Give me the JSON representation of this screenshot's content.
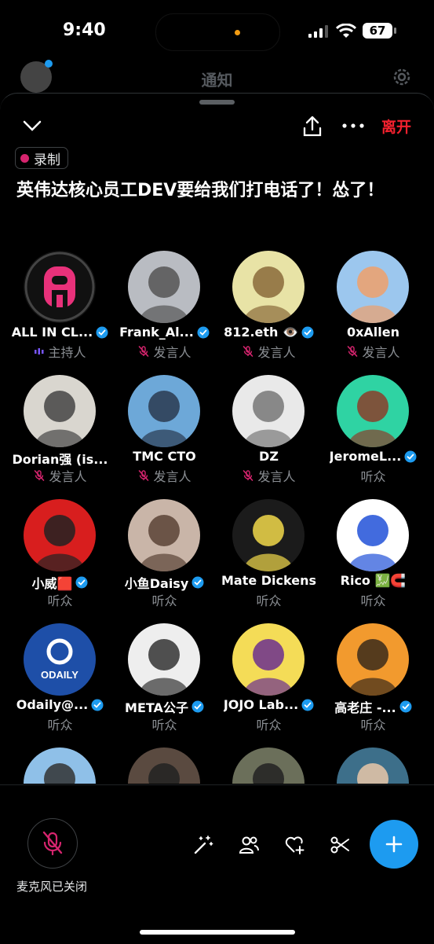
{
  "status_bar": {
    "time": "9:40",
    "battery": "67"
  },
  "background_header": {
    "title": "通知"
  },
  "space": {
    "leave_label": "离开",
    "recording_label": "录制",
    "title": "英伟达核心员工DEV要给我们打电话了！怂了！"
  },
  "participants": [
    {
      "name": "ALL IN CL...",
      "role": "主持人",
      "verified": true,
      "role_icon": "host-bars-icon",
      "avatar_bg": "#111",
      "avatar_fg": "#e8317a",
      "avatar_text": "A"
    },
    {
      "name": "Frank_Al...",
      "role": "发言人",
      "verified": true,
      "role_icon": "muted-mic-icon",
      "avatar_bg": "#b9bcc2",
      "avatar_fg": "#555",
      "avatar_text": ""
    },
    {
      "name": "812.eth 👁️",
      "role": "发言人",
      "verified": true,
      "role_icon": "muted-mic-icon",
      "avatar_bg": "#e8e3a6",
      "avatar_fg": "#8a6a3a",
      "avatar_text": ""
    },
    {
      "name": "0xAllen",
      "role": "发言人",
      "verified": false,
      "role_icon": "muted-mic-icon",
      "avatar_bg": "#9cc7ee",
      "avatar_fg": "#f0a06a",
      "avatar_text": ""
    },
    {
      "name": "Dorian强 (is...",
      "role": "发言人",
      "verified": false,
      "role_icon": "muted-mic-icon",
      "avatar_bg": "#d9d6cf",
      "avatar_fg": "#444",
      "avatar_text": ""
    },
    {
      "name": "TMC CTO",
      "role": "发言人",
      "verified": false,
      "role_icon": "muted-mic-icon",
      "avatar_bg": "#6da8d8",
      "avatar_fg": "#2a3950",
      "avatar_text": ""
    },
    {
      "name": "DZ",
      "role": "发言人",
      "verified": false,
      "role_icon": "muted-mic-icon",
      "avatar_bg": "#e9e9e9",
      "avatar_fg": "#777",
      "avatar_text": ""
    },
    {
      "name": "JeromeL...",
      "role": "听众",
      "verified": true,
      "role_icon": "",
      "avatar_bg": "#2fd3a3",
      "avatar_fg": "#8b3d2a",
      "avatar_text": ""
    },
    {
      "name": "小威🟥",
      "role": "听众",
      "verified": true,
      "role_icon": "",
      "avatar_bg": "#d81e1e",
      "avatar_fg": "#222",
      "avatar_text": ""
    },
    {
      "name": "小鱼Daisy",
      "role": "听众",
      "verified": true,
      "role_icon": "",
      "avatar_bg": "#c9b5a8",
      "avatar_fg": "#5a4336",
      "avatar_text": ""
    },
    {
      "name": "Mate Dickens",
      "role": "听众",
      "verified": false,
      "role_icon": "",
      "avatar_bg": "#1b1b1b",
      "avatar_fg": "#f1d84a",
      "avatar_text": ""
    },
    {
      "name": "Rico 💹🧲",
      "role": "听众",
      "verified": false,
      "role_icon": "",
      "avatar_bg": "#ffffff",
      "avatar_fg": "#2151d8",
      "avatar_text": ""
    },
    {
      "name": "Odaily@...",
      "role": "听众",
      "verified": true,
      "role_icon": "",
      "avatar_bg": "#1e4fa8",
      "avatar_fg": "#ffffff",
      "avatar_text": "ODAILY"
    },
    {
      "name": "META公子",
      "role": "听众",
      "verified": true,
      "role_icon": "",
      "avatar_bg": "#eeeeee",
      "avatar_fg": "#333",
      "avatar_text": ""
    },
    {
      "name": "JOJO Lab...",
      "role": "听众",
      "verified": true,
      "role_icon": "",
      "avatar_bg": "#f4dc57",
      "avatar_fg": "#6b2f8e",
      "avatar_text": ""
    },
    {
      "name": "高老庄 -...",
      "role": "听众",
      "verified": true,
      "role_icon": "",
      "avatar_bg": "#f29a2e",
      "avatar_fg": "#3a2a1a",
      "avatar_text": ""
    },
    {
      "name": "",
      "role": "",
      "verified": false,
      "role_icon": "",
      "avatar_bg": "#8fc0e8",
      "avatar_fg": "#333",
      "avatar_text": ""
    },
    {
      "name": "",
      "role": "",
      "verified": false,
      "role_icon": "",
      "avatar_bg": "#5a4a40",
      "avatar_fg": "#222",
      "avatar_text": ""
    },
    {
      "name": "",
      "role": "",
      "verified": false,
      "role_icon": "",
      "avatar_bg": "#6b6f5a",
      "avatar_fg": "#222",
      "avatar_text": ""
    },
    {
      "name": "",
      "role": "",
      "verified": false,
      "role_icon": "",
      "avatar_bg": "#3d6f8a",
      "avatar_fg": "#e9c8a8",
      "avatar_text": ""
    }
  ],
  "bottom_bar": {
    "mic_label": "麦克风已关闭"
  },
  "colors": {
    "accent": "#1d9bf0",
    "leave": "#f4212e",
    "recording": "#d6246e",
    "muted_mic": "#d6246e",
    "host_bars": "#7856ff"
  }
}
